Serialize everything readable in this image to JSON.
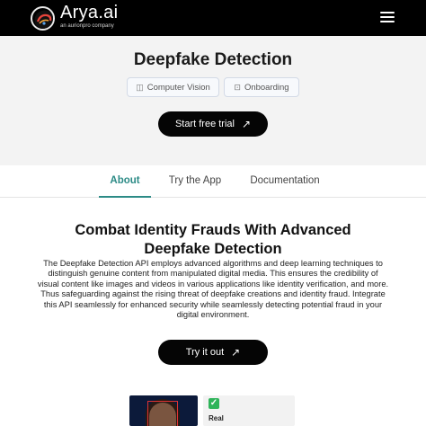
{
  "header": {
    "brand_name": "Arya.ai",
    "brand_sub": "an aurionpro company",
    "logo_icon": "arya-logo-icon",
    "menu_icon": "hamburger-menu-icon"
  },
  "hero": {
    "title": "Deepfake Detection",
    "chips": [
      {
        "label": "Computer Vision",
        "icon": "computer-vision-icon"
      },
      {
        "label": "Onboarding",
        "icon": "onboarding-icon"
      }
    ],
    "cta_label": "Start free trial",
    "cta_icon": "arrow-up-right-icon"
  },
  "tabs": [
    {
      "label": "About",
      "active": true
    },
    {
      "label": "Try the App",
      "active": false
    },
    {
      "label": "Documentation",
      "active": false
    }
  ],
  "about": {
    "title_line1": "Combat Identity Frauds With Advanced",
    "title_line2": "Deepfake Detection",
    "body_lines": [
      "The Deepfake Detection API employs advanced algorithms and deep learning techniques to",
      "distinguish genuine content from manipulated digital media. This ensures the credibility of",
      "visual content like images and videos in various applications like identity verification, and more.",
      "Thus safeguarding against the rising threat of deepfake creations and identity fraud. Integrate",
      "this API seamlessly for enhanced security while seamlessly detecting potential fraud in your",
      "digital environment."
    ],
    "try_label": "Try it out",
    "try_icon": "arrow-up-right-icon"
  },
  "demo": {
    "result_label": "Real",
    "result_icon": "check-icon"
  },
  "colors": {
    "accent": "#2c8b86",
    "topbar": "#000000",
    "hero_bg": "#f3f3f3",
    "button": "#050505"
  }
}
